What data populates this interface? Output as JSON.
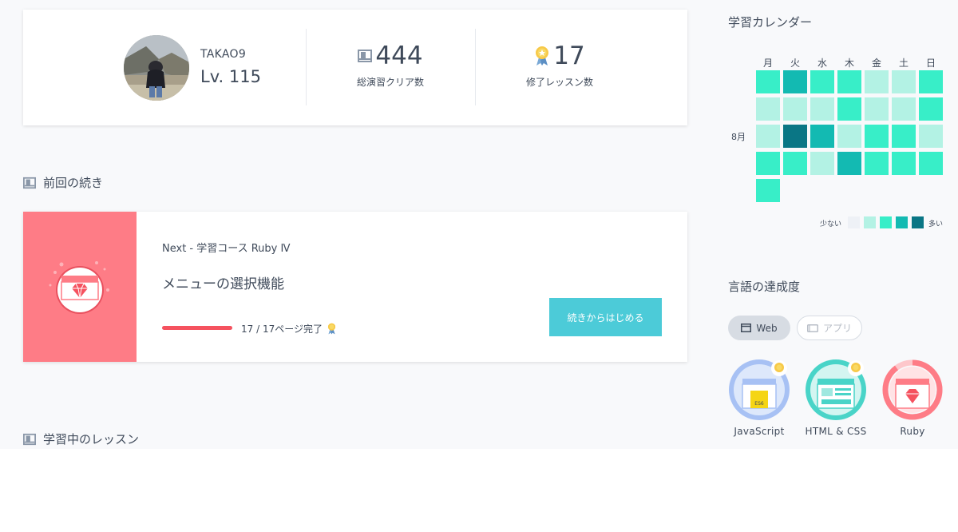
{
  "profile": {
    "username": "TAKAO9",
    "level": "Lv. 115",
    "stats": [
      {
        "value": "444",
        "label": "総演習クリア数",
        "icon": "book-icon"
      },
      {
        "value": "17",
        "label": "修了レッスン数",
        "icon": "medal-icon"
      }
    ]
  },
  "continue_section": {
    "heading": "前回の続き",
    "next_label": "Next - 学習コース Ruby Ⅳ",
    "lesson_title": "メニューの選択機能",
    "progress_text": "17 / 17ページ完了",
    "progress_fraction": 1.0,
    "button_label": "続きからはじめる",
    "thumb_color": "#fe7c86"
  },
  "current_lessons": {
    "heading": "学習中のレッスン"
  },
  "calendar": {
    "title": "学習カレンダー",
    "weekdays": [
      "月",
      "火",
      "水",
      "木",
      "金",
      "土",
      "日"
    ],
    "month_label": "8月",
    "levels": [
      [
        2,
        3,
        2,
        2,
        1,
        1,
        2
      ],
      [
        1,
        1,
        1,
        2,
        1,
        1,
        2
      ],
      [
        1,
        4,
        3,
        1,
        2,
        2,
        1
      ],
      [
        2,
        2,
        1,
        3,
        2,
        2,
        2
      ],
      [
        2
      ]
    ],
    "level_colors": [
      "#eef1f6",
      "#b3f2e4",
      "#38eec8",
      "#13bab2",
      "#0a7685"
    ],
    "legend_less": "少ない",
    "legend_more": "多い"
  },
  "languages": {
    "title": "言語の達成度",
    "tabs": [
      {
        "label": "Web",
        "active": true,
        "icon": "window-icon"
      },
      {
        "label": "アプリ",
        "active": false,
        "icon": "mobile-icon"
      }
    ],
    "items": [
      {
        "name": "JavaScript",
        "badge_label": "ES6",
        "completed": true,
        "color": "#a7c1f4"
      },
      {
        "name": "HTML & CSS",
        "completed": true,
        "color": "#49d4c8"
      },
      {
        "name": "Ruby",
        "completed": false,
        "progress": 0.9,
        "color": "#fe7c86"
      }
    ]
  }
}
